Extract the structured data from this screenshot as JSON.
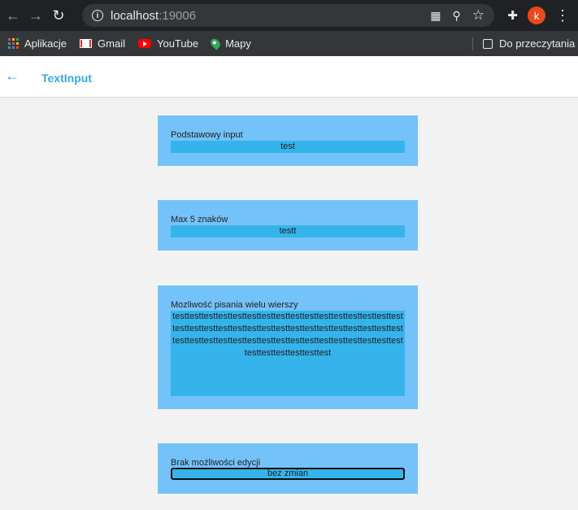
{
  "browser": {
    "url_host": "localhost",
    "url_port": ":19006",
    "profile_initial": "k",
    "bookmarks": [
      "Aplikacje",
      "Gmail",
      "YouTube",
      "Mapy"
    ],
    "reading_list": "Do przeczytania"
  },
  "header": {
    "title": "TextInput"
  },
  "cards": [
    {
      "label": "Podstawowy input",
      "value": "test"
    },
    {
      "label": "Max 5 znaków",
      "value": "testt"
    },
    {
      "label": "Mozliwość pisania wielu wierszy",
      "value": "testtesttesttesttesttesttesttesttesttesttesttesttesttesttesttesttesttesttesttesttesttesttesttesttesttesttesttesttesttesttesttesttesttesttesttesttesttesttesttesttesttesttesttesttesttesttesttesttesttesttesttesttesttest"
    },
    {
      "label": "Brak możliwości edycji",
      "value": "bez zmian"
    }
  ]
}
